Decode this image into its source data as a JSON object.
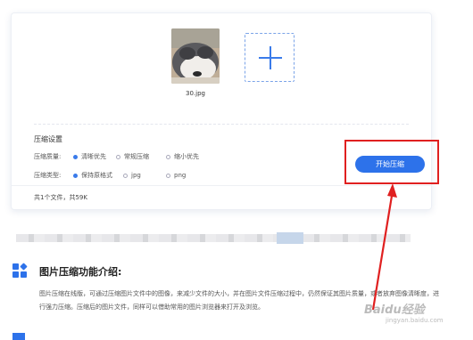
{
  "upload": {
    "file_name": "30.jpg",
    "add_icon": "plus-icon"
  },
  "settings": {
    "title": "压缩设置",
    "quality_label": "压缩质量:",
    "quality_options": [
      "清晰优先",
      "常规压缩",
      "缩小优先"
    ],
    "quality_selected": "清晰优先",
    "type_label": "压缩类型:",
    "type_options": [
      "保持原格式",
      "jpg",
      "png"
    ],
    "type_selected": "保持原格式",
    "start_button": "开始压缩"
  },
  "summary": "共1个文件，共59K",
  "intro": {
    "title": "图片压缩功能介绍:",
    "text": "图片压缩在线版，可通过压缩图片文件中的图像，来减少文件的大小，并在图片文件压缩过程中，仍然保证其图片质量，或者放弃图像清晰度，进行强力压缩。压缩后的图片文件，同样可以借助常用的图片浏览器来打开及浏览。"
  },
  "watermark": {
    "text": "Baidu经验",
    "sub": "jingyan.baidu.com"
  },
  "colors": {
    "accent": "#2d72ea",
    "highlight": "#e02020"
  }
}
